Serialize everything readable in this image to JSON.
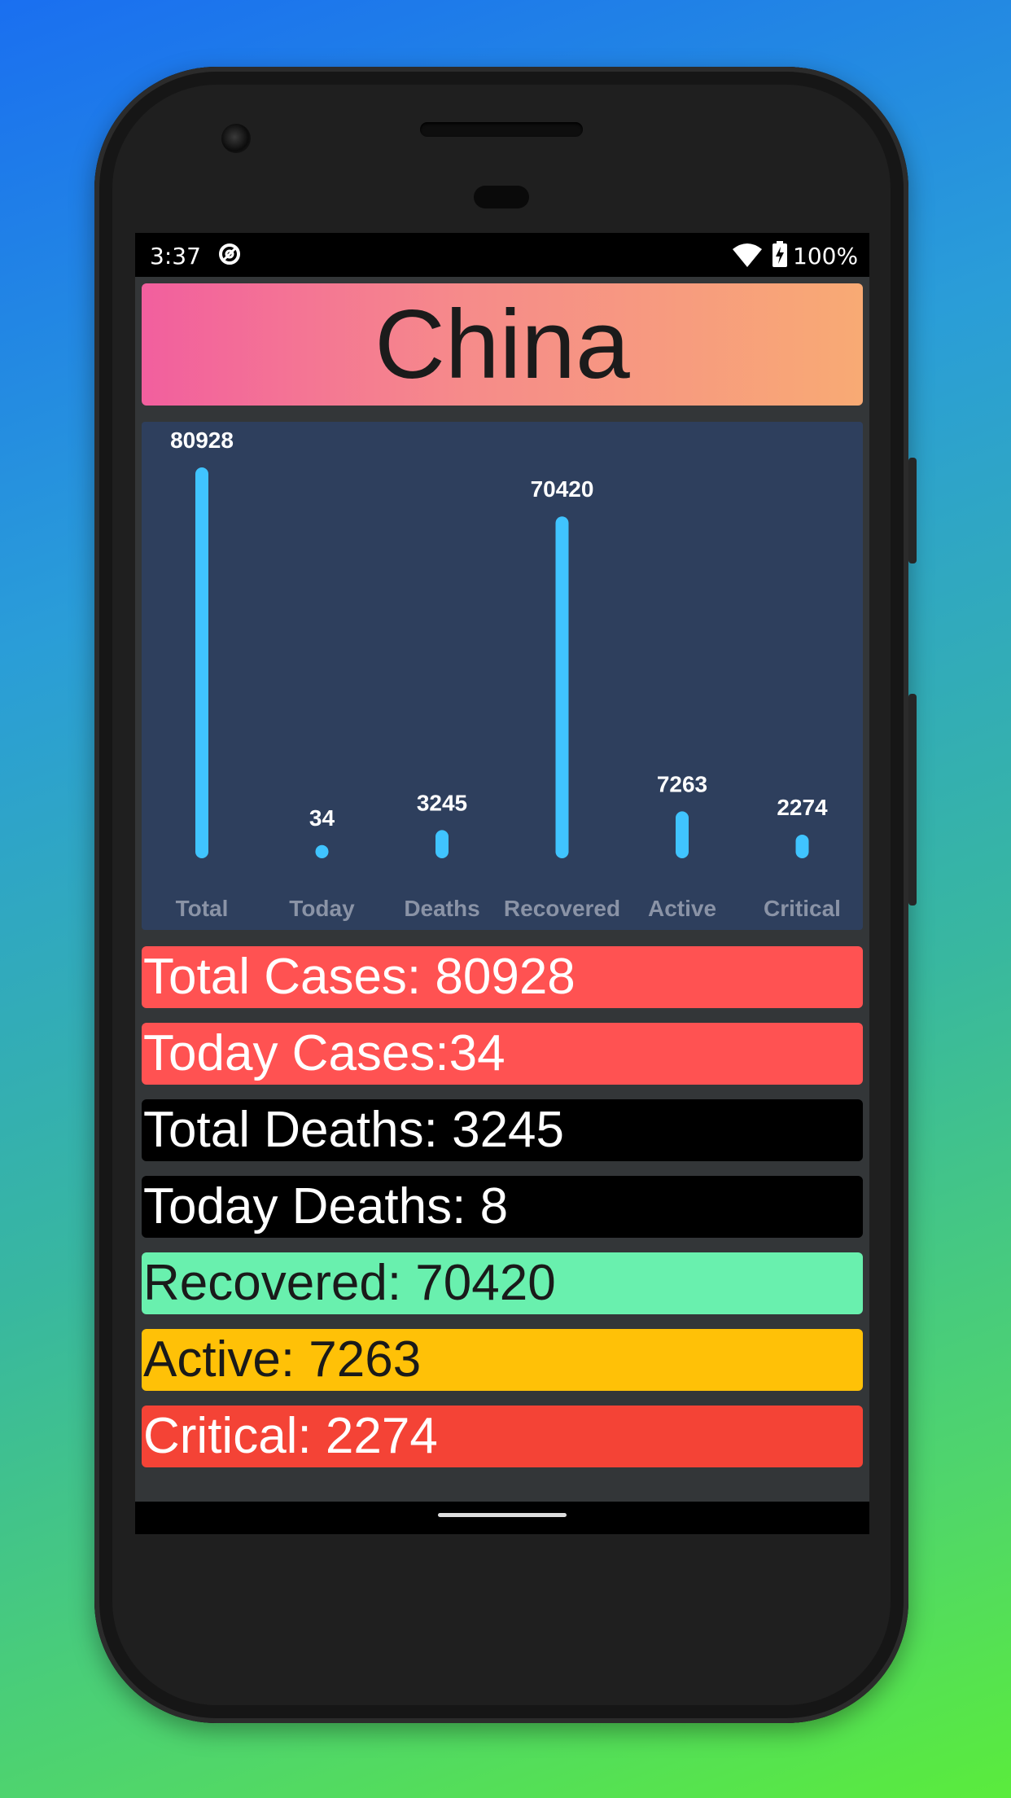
{
  "status_bar": {
    "time": "3:37",
    "battery": "100%"
  },
  "country": "China",
  "chart_data": {
    "type": "bar",
    "categories": [
      "Total",
      "Today",
      "Deaths",
      "Recovered",
      "Active",
      "Critical"
    ],
    "values": [
      80928,
      34,
      3245,
      70420,
      7263,
      2274
    ],
    "title": "",
    "xlabel": "",
    "ylabel": "",
    "grid": false,
    "bar_color": "#40c4ff"
  },
  "stats": [
    {
      "text": "Total Cases: 80928",
      "bg": "#ff5252",
      "fg": "#ffffff"
    },
    {
      "text": "Today Cases:34",
      "bg": "#ff5252",
      "fg": "#ffffff"
    },
    {
      "text": "Total Deaths: 3245",
      "bg": "#000000",
      "fg": "#ffffff"
    },
    {
      "text": "Today Deaths: 8",
      "bg": "#000000",
      "fg": "#ffffff"
    },
    {
      "text": "Recovered: 70420",
      "bg": "#69f0ae",
      "fg": "#1a1a1a"
    },
    {
      "text": "Active: 7263",
      "bg": "#ffc107",
      "fg": "#1a1a1a"
    },
    {
      "text": "Critical: 2274",
      "bg": "#f44336",
      "fg": "#ffffff"
    }
  ]
}
